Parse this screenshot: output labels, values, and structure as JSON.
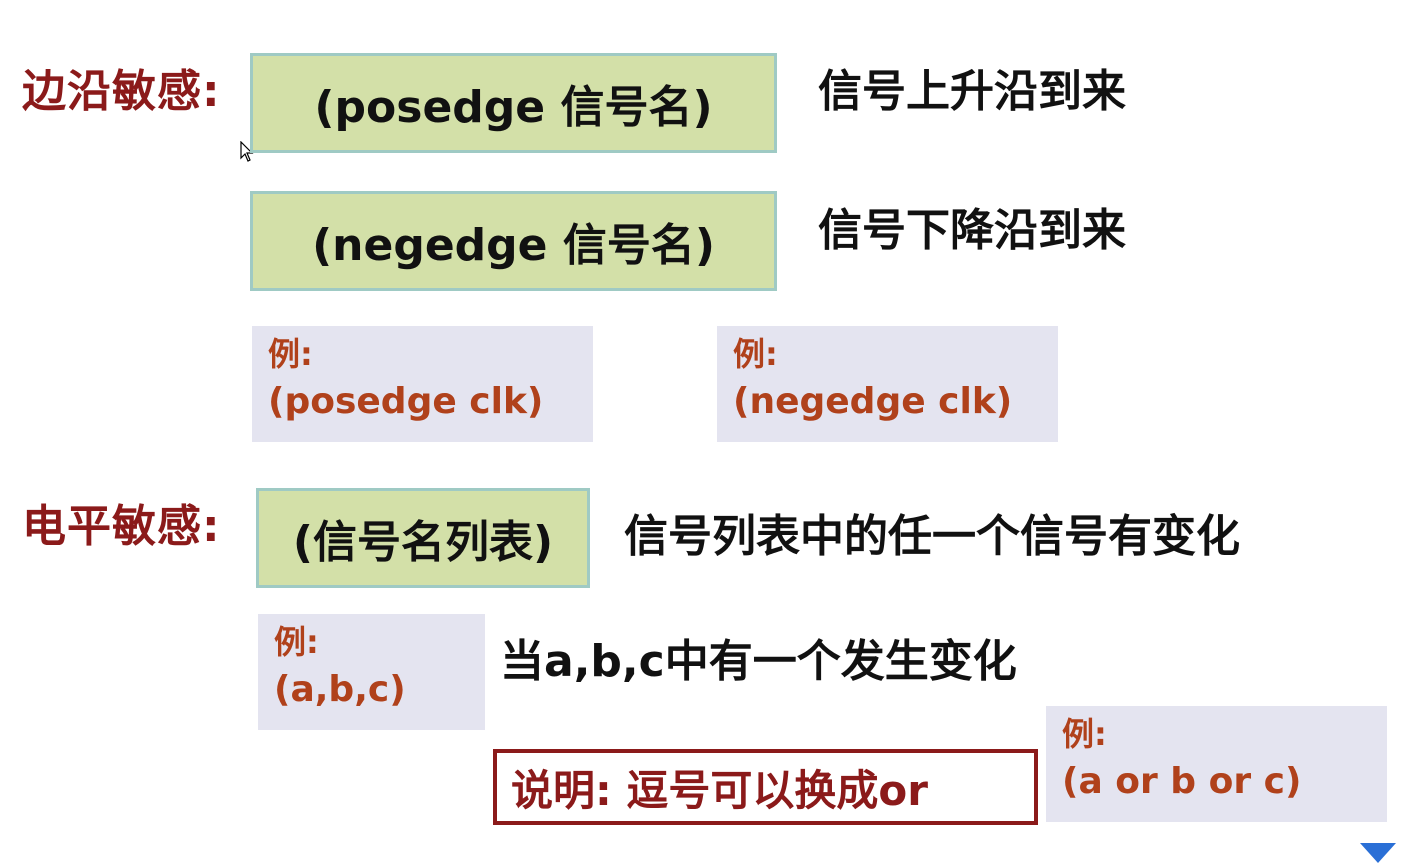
{
  "edge": {
    "label": "边沿敏感:",
    "posedge_box": "(posedge 信号名)",
    "posedge_desc": "信号上升沿到来",
    "negedge_box": "(negedge 信号名)",
    "negedge_desc": "信号下降沿到来",
    "example1": {
      "label": "例:",
      "code": "(posedge clk)"
    },
    "example2": {
      "label": "例:",
      "code": "(negedge clk)"
    }
  },
  "level": {
    "label": "电平敏感:",
    "box": "(信号名列表)",
    "desc": "信号列表中的任一个信号有变化",
    "example1": {
      "label": "例:",
      "code": "(a,b,c)"
    },
    "example1_desc": "当a,b,c中有一个发生变化",
    "note": "说明: 逗号可以换成or",
    "example2": {
      "label": "例:",
      "code": "(a or b or c)"
    }
  },
  "icons": {
    "cursor": "mouse-pointer-icon",
    "corner": "triangle-down-icon"
  },
  "colors": {
    "label_red": "#8b1a1a",
    "example_orange": "#b0411b",
    "box_green": "#d3e0a8",
    "box_border_teal": "#9fcac4",
    "example_bg": "#e4e4f0"
  }
}
